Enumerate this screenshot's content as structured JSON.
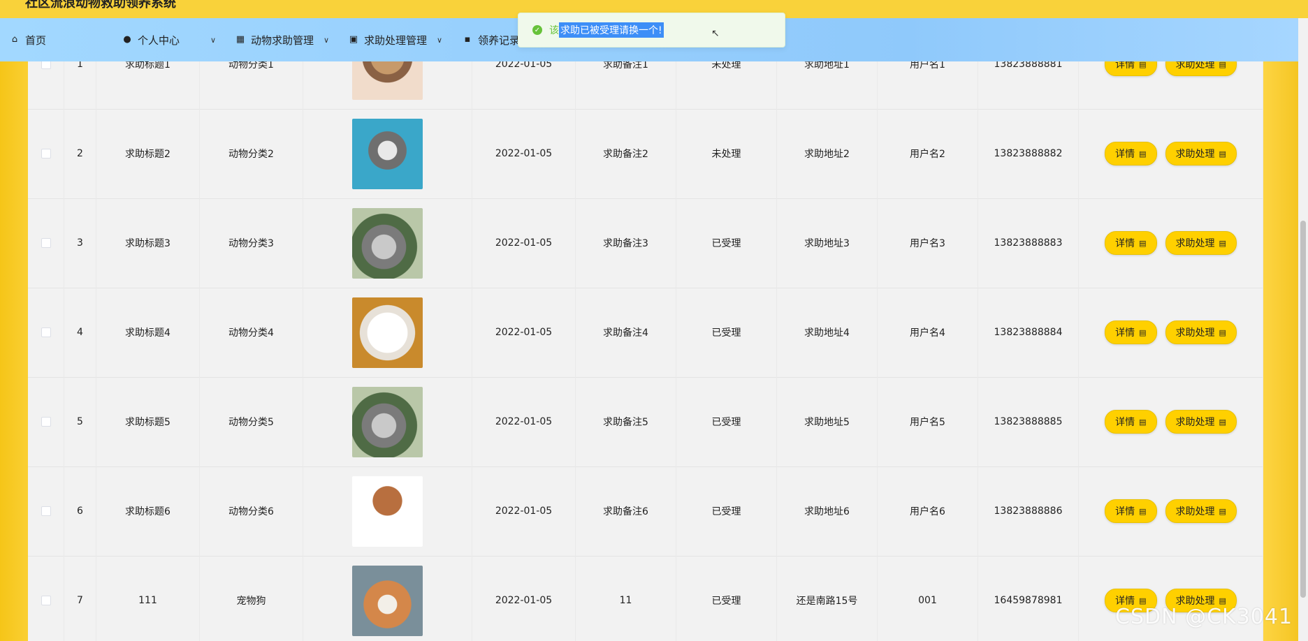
{
  "site_title": "社区流浪动物救助领养系统",
  "nav": [
    {
      "label": "首页",
      "icon": "home-icon",
      "has_caret": false
    },
    {
      "label": "个人中心",
      "icon": "user-icon",
      "has_caret": true
    },
    {
      "label": "动物求助管理",
      "icon": "grid-icon",
      "has_caret": true
    },
    {
      "label": "求助处理管理",
      "icon": "clipboard-check-icon",
      "has_caret": true
    },
    {
      "label": "领养记录",
      "icon": "apps-icon",
      "has_caret": true
    }
  ],
  "toast": {
    "prefix": "该",
    "selected": "求助已被受理请换一个!",
    "type": "success"
  },
  "buttons": {
    "detail": "详情",
    "handle": "求助处理"
  },
  "rows": [
    {
      "index": "1",
      "title": "求助标题1",
      "category": "动物分类1",
      "image": "pug-photo",
      "date": "2022-01-05",
      "remark": "求助备注1",
      "status": "未处理",
      "address": "求助地址1",
      "username": "用户名1",
      "phone": "13823888881"
    },
    {
      "index": "2",
      "title": "求助标题2",
      "category": "动物分类2",
      "image": "schnauzer-photo",
      "date": "2022-01-05",
      "remark": "求助备注2",
      "status": "未处理",
      "address": "求助地址2",
      "username": "用户名2",
      "phone": "13823888882"
    },
    {
      "index": "3",
      "title": "求助标题3",
      "category": "动物分类3",
      "image": "chinchilla-photo",
      "date": "2022-01-05",
      "remark": "求助备注3",
      "status": "已受理",
      "address": "求助地址3",
      "username": "用户名3",
      "phone": "13823888883"
    },
    {
      "index": "4",
      "title": "求助标题4",
      "category": "动物分类4",
      "image": "white-puppy-photo",
      "date": "2022-01-05",
      "remark": "求助备注4",
      "status": "已受理",
      "address": "求助地址4",
      "username": "用户名4",
      "phone": "13823888884"
    },
    {
      "index": "5",
      "title": "求助标题5",
      "category": "动物分类5",
      "image": "chinchilla-photo",
      "date": "2022-01-05",
      "remark": "求助备注5",
      "status": "已受理",
      "address": "求助地址5",
      "username": "用户名5",
      "phone": "13823888885"
    },
    {
      "index": "6",
      "title": "求助标题6",
      "category": "动物分类6",
      "image": "poodle-photo",
      "date": "2022-01-05",
      "remark": "求助备注6",
      "status": "已受理",
      "address": "求助地址6",
      "username": "用户名6",
      "phone": "13823888886"
    },
    {
      "index": "7",
      "title": "111",
      "category": "宠物狗",
      "image": "shiba-photo",
      "date": "2022-01-05",
      "remark": "11",
      "status": "已受理",
      "address": "还是南路15号",
      "username": "001",
      "phone": "16459878981"
    }
  ],
  "watermark": "CSDN @CK3041",
  "colors": {
    "accent": "#ffd000",
    "nav_bg": "#a2d8ff",
    "toast_bg": "#f0f9eb",
    "toast_text": "#67c23a"
  }
}
